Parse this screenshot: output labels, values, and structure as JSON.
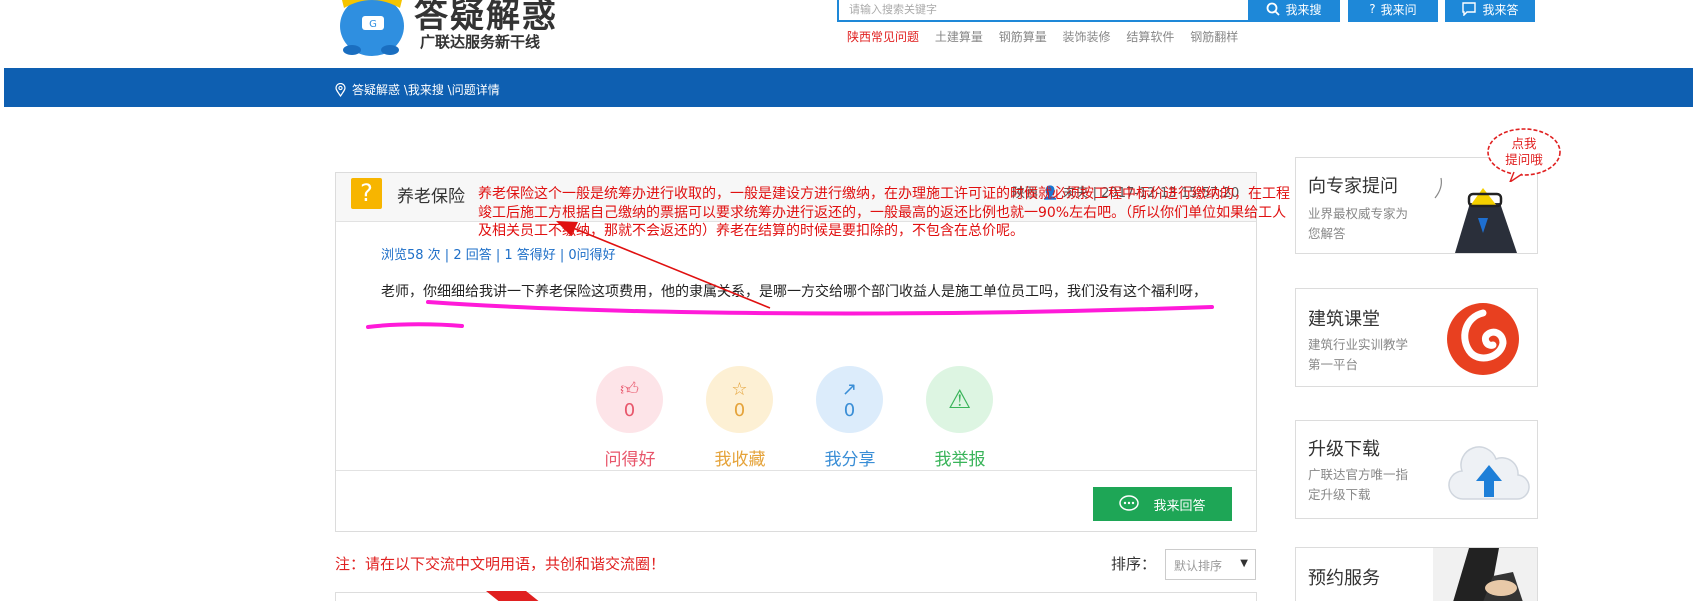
{
  "header": {
    "logo_title": "答疑解惑",
    "logo_subtitle": "广联达服务新干线",
    "search_placeholder": "请输入搜索关键字",
    "search_button": "我来搜",
    "ask_button": "我来问",
    "answer_button": "我来答",
    "hot_links": [
      "陕西常见问题",
      "土建算量",
      "钢筋算量",
      "装饰装修",
      "结算软件",
      "钢筋翻样"
    ]
  },
  "breadcrumb": "答疑解惑 \\我来搜 \\问题详情",
  "question": {
    "title": "养老保险",
    "region": "陕西",
    "author": "未央",
    "datetime": "2017-12-13 15:57:20",
    "stats": "浏览58 次 | 2 回答 | 1 答得好 | 0问得好",
    "body": "老师，你细细给我讲一下养老保险这项费用，他的隶属关系，是哪一方交给哪个部门收益人是施工单位员工吗，我们没有这个福利呀，"
  },
  "annotation": "养老保险这个一般是统筹办进行收取的，一般是建设方进行缴纳，在办理施工许可证的时候就必须按工程中标价进行缴纳的，在工程竣工后施工方根据自己缴纳的票据可以要求统筹办进行返还的，一般最高的返还比例也就一90%左右吧。（所以你们单位如果给工人及相关员工不缴纳，那就不会返还的）养老在结算的时候是要扣除的，不包含在总价呢。",
  "actions": [
    {
      "label": "问得好",
      "count": "0",
      "icon": "thumbs-up-icon"
    },
    {
      "label": "我收藏",
      "count": "0",
      "icon": "star-icon"
    },
    {
      "label": "我分享",
      "count": "0",
      "icon": "share-icon"
    },
    {
      "label": "我举报",
      "count": "",
      "icon": "warning-icon"
    }
  ],
  "reply_button": "我来回答",
  "note": "注：请在以下交流中文明用语，共创和谐交流圈！",
  "sort": {
    "label": "排序：",
    "selected": "默认排序"
  },
  "sidebar": {
    "badge": "点我\n提问哦",
    "cards": [
      {
        "title": "向专家提问",
        "subtitle": "业界最权威专家为您解答"
      },
      {
        "title": "建筑课堂",
        "subtitle": "建筑行业实训教学第一平台"
      },
      {
        "title": "升级下载",
        "subtitle": "广联达官方唯一指定升级下载"
      },
      {
        "title": "预约服务",
        "subtitle": ""
      }
    ]
  },
  "colors": {
    "nav": "#0e5fb1",
    "search_blue": "#1e88d8",
    "annotation_red": "#e01010",
    "highlight_magenta": "#ff1ad9",
    "reply_green": "#1ea656"
  }
}
